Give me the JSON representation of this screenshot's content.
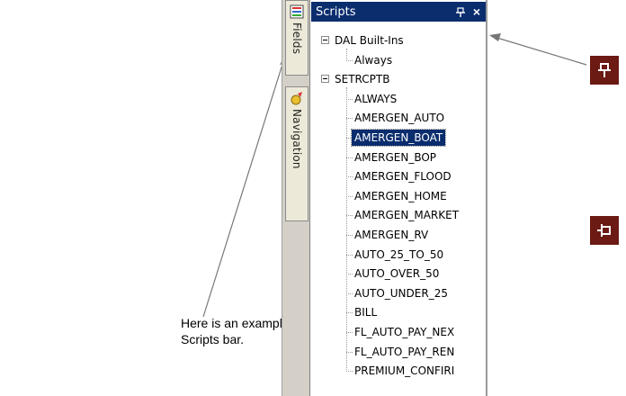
{
  "annotation": {
    "text": "Here is an example of the Scripts bar."
  },
  "tabs": [
    {
      "label": "Fields",
      "icon": "fields-icon"
    },
    {
      "label": "Navigation",
      "icon": "navigation-icon"
    }
  ],
  "panel": {
    "title": "Scripts",
    "pin_icon": "pin-icon",
    "close_glyph": "×"
  },
  "tree": {
    "groups": [
      {
        "label": "DAL Built-Ins",
        "expanded": true,
        "children": [
          "Always"
        ]
      },
      {
        "label": "SETRCPTB",
        "expanded": true,
        "children": [
          "ALWAYS",
          "AMERGEN_AUTO",
          "AMERGEN_BOAT",
          "AMERGEN_BOP",
          "AMERGEN_FLOOD",
          "AMERGEN_HOME",
          "AMERGEN_MARKET",
          "AMERGEN_RV",
          "AUTO_25_TO_50",
          "AUTO_OVER_50",
          "AUTO_UNDER_25",
          "BILL",
          "FL_AUTO_PAY_NEX",
          "FL_AUTO_PAY_REN",
          "PREMIUM_CONFIRI"
        ]
      }
    ],
    "selected": "AMERGEN_BOAT"
  },
  "side_icons": [
    {
      "name": "pin-icon"
    },
    {
      "name": "unpin-icon"
    }
  ],
  "colors": {
    "titlebar": "#0a2d6e",
    "selection": "#0a2d6e",
    "side_icon_bg": "#6b1a14"
  }
}
